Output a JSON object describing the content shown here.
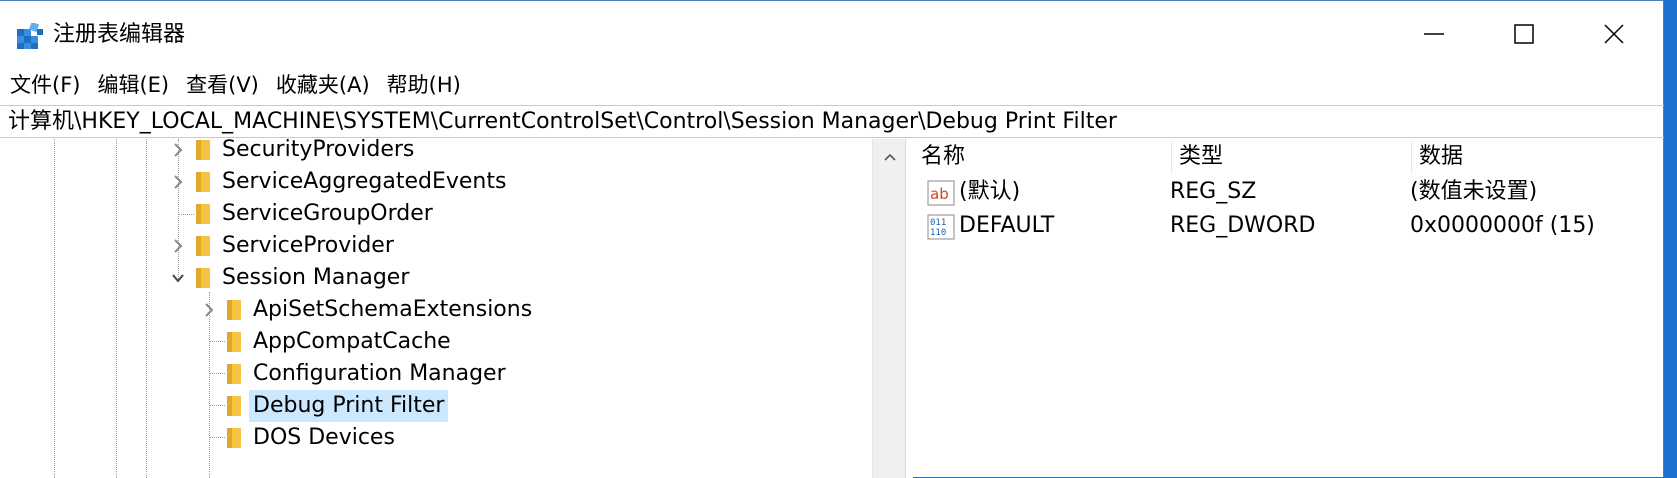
{
  "window": {
    "title": "注册表编辑器"
  },
  "menu": [
    "文件(F)",
    "编辑(E)",
    "查看(V)",
    "收藏夹(A)",
    "帮助(H)"
  ],
  "address": "计算机\\HKEY_LOCAL_MACHINE\\SYSTEM\\CurrentControlSet\\Control\\Session Manager\\Debug Print Filter",
  "tree": [
    {
      "label": "SecurityProviders",
      "expander": "collapsed",
      "level": 0
    },
    {
      "label": "ServiceAggregatedEvents",
      "expander": "collapsed",
      "level": 0
    },
    {
      "label": "ServiceGroupOrder",
      "expander": "none",
      "level": 0
    },
    {
      "label": "ServiceProvider",
      "expander": "collapsed",
      "level": 0
    },
    {
      "label": "Session Manager",
      "expander": "expanded",
      "level": 0
    },
    {
      "label": "ApiSetSchemaExtensions",
      "expander": "collapsed",
      "level": 1
    },
    {
      "label": "AppCompatCache",
      "expander": "none",
      "level": 1
    },
    {
      "label": "Configuration Manager",
      "expander": "none",
      "level": 1
    },
    {
      "label": "Debug Print Filter",
      "expander": "none",
      "level": 1,
      "selected": true
    },
    {
      "label": "DOS Devices",
      "expander": "none",
      "level": 1
    }
  ],
  "values_pane": {
    "headers": {
      "name": "名称",
      "type": "类型",
      "data": "数据"
    },
    "rows": [
      {
        "icon": "string-value-icon",
        "name": "(默认)",
        "type": "REG_SZ",
        "data": "(数值未设置)"
      },
      {
        "icon": "binary-value-icon",
        "name": "DEFAULT",
        "type": "REG_DWORD",
        "data": "0x0000000f (15)"
      }
    ]
  },
  "colors": {
    "selection": "#cce8ff",
    "desktop": "#1f6fcf",
    "folder": "#f5c242"
  }
}
